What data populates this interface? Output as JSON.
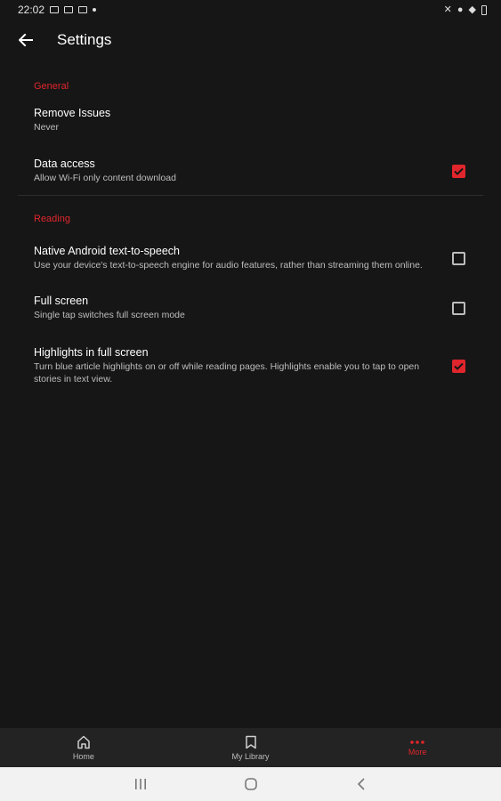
{
  "status_bar": {
    "time": "22:02"
  },
  "app_bar": {
    "title": "Settings"
  },
  "sections": {
    "general": {
      "header": "General",
      "remove_issues": {
        "title": "Remove Issues",
        "subtitle": "Never"
      },
      "data_access": {
        "title": "Data access",
        "subtitle": "Allow Wi-Fi only content download",
        "checked": true
      }
    },
    "reading": {
      "header": "Reading",
      "native_tts": {
        "title": "Native Android text-to-speech",
        "subtitle": "Use your device's text-to-speech engine for audio features, rather than streaming them online.",
        "checked": false
      },
      "full_screen": {
        "title": "Full screen",
        "subtitle": "Single tap switches full screen mode",
        "checked": false
      },
      "highlights": {
        "title": "Highlights in full screen",
        "subtitle": "Turn blue article highlights on or off while reading pages. Highlights enable you to tap to open stories in text view.",
        "checked": true
      }
    }
  },
  "bottom_nav": {
    "home": {
      "label": "Home",
      "icon": "home-icon"
    },
    "library": {
      "label": "My Library",
      "icon": "bookmark-icon"
    },
    "more": {
      "label": "More",
      "icon": "more-dots-icon",
      "active": true
    }
  },
  "colors": {
    "accent": "#e0262c",
    "background": "#161616",
    "nav_background": "#232323"
  }
}
